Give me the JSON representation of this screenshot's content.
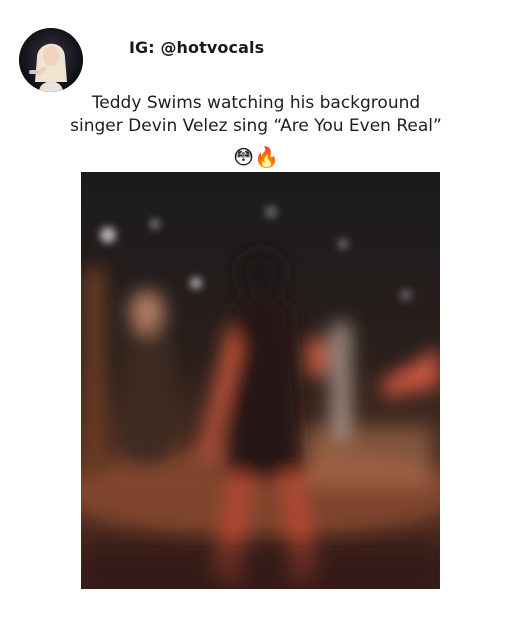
{
  "post": {
    "handle": "IG: @hotvocals",
    "caption_line1": "Teddy Swims watching his background",
    "caption_line2": "singer Devin Velez sing “Are You Even Real”",
    "emojis": "😳🔥"
  },
  "avatar": {
    "icon": "profile-photo-icon",
    "background_color": "#0b0b10",
    "hair_color": "#efe4cf"
  },
  "video": {
    "description_icon": "blurred-concert-video",
    "stage_glow_color": "#c0553a",
    "background_color": "#1a1210"
  }
}
